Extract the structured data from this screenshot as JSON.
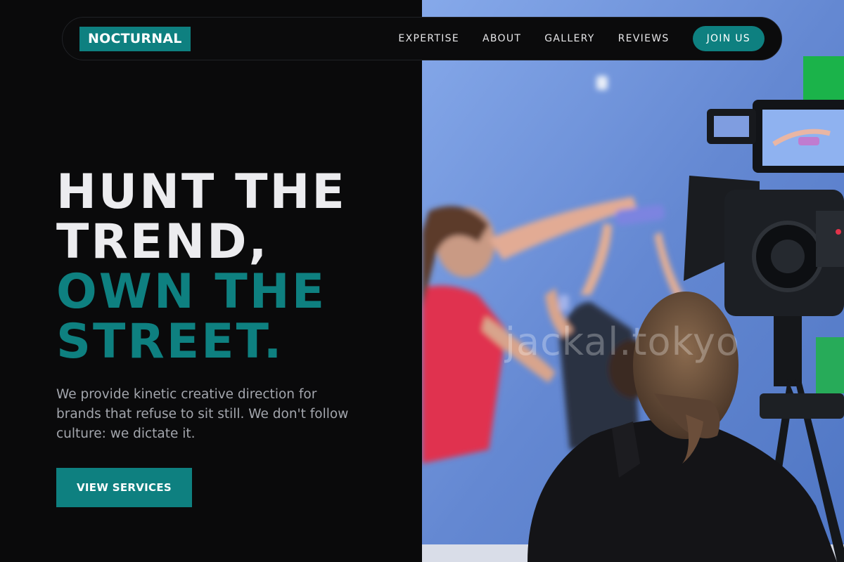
{
  "brand": {
    "logo_text": "NOCTURNAL",
    "accent_color": "#0e8080"
  },
  "nav": {
    "links": [
      "EXPERTISE",
      "ABOUT",
      "GALLERY",
      "REVIEWS"
    ],
    "cta_label": "JOIN US"
  },
  "hero": {
    "headline_line1": "HUNT THE",
    "headline_line2": "TREND,",
    "headline_accent_line1": "OWN THE",
    "headline_accent_line2": "STREET.",
    "description": "We provide kinetic creative direction for brands that refuse to sit still. We don't follow culture: we dictate it.",
    "cta_label": "VIEW SERVICES"
  },
  "image": {
    "watermark_text": "jackal.tokyo"
  }
}
